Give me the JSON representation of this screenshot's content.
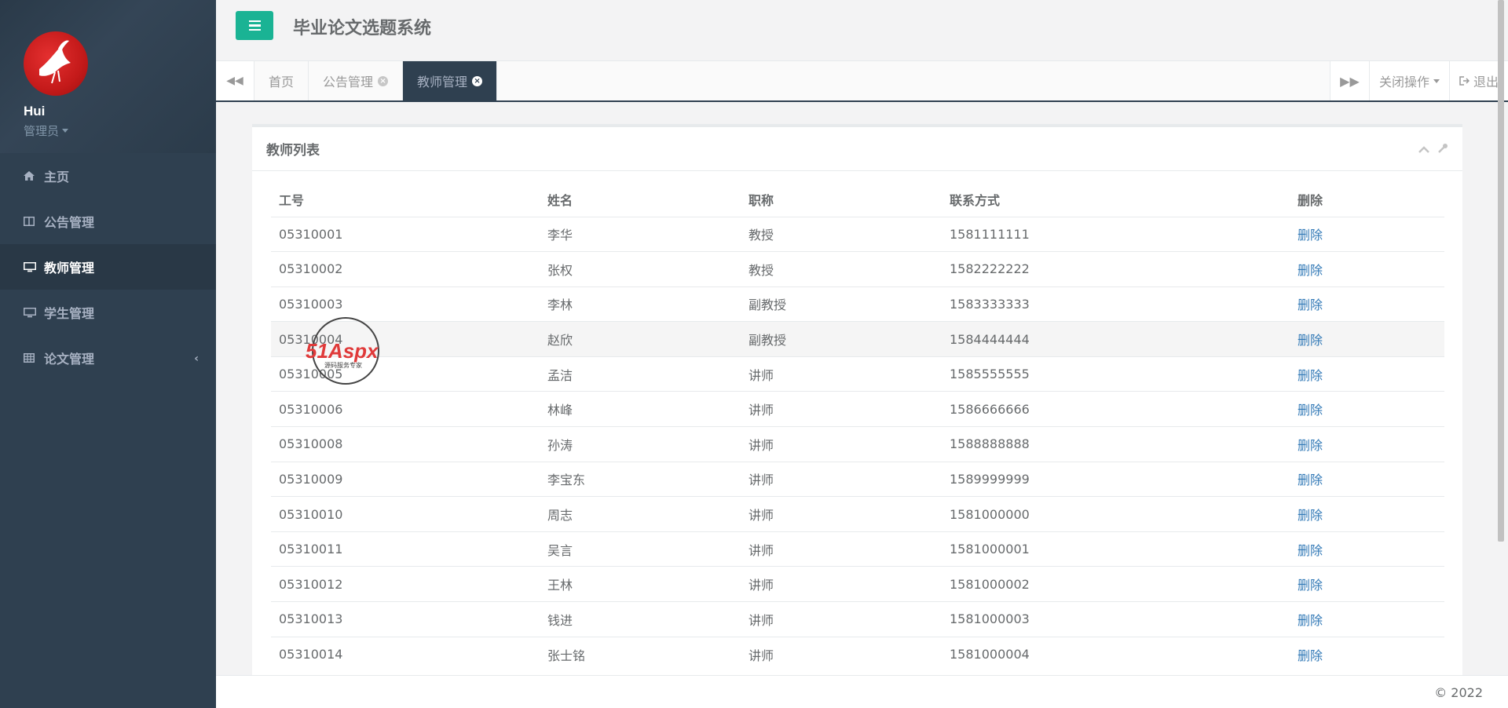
{
  "profile": {
    "name": "Hui",
    "role": "管理员"
  },
  "sidebar": {
    "items": [
      {
        "label": "主页",
        "icon": "home-icon"
      },
      {
        "label": "公告管理",
        "icon": "columns-icon"
      },
      {
        "label": "教师管理",
        "icon": "desktop-icon",
        "active": true
      },
      {
        "label": "学生管理",
        "icon": "desktop-icon"
      },
      {
        "label": "论文管理",
        "icon": "table-icon",
        "has_submenu": true
      }
    ]
  },
  "header": {
    "title": "毕业论文选题系统"
  },
  "tabs": [
    {
      "label": "首页",
      "closable": false
    },
    {
      "label": "公告管理",
      "closable": true
    },
    {
      "label": "教师管理",
      "closable": true,
      "active": true
    }
  ],
  "tabbar_right": {
    "close_ops": "关闭操作",
    "logout": "退出"
  },
  "panel": {
    "title": "教师列表",
    "headers": [
      "工号",
      "姓名",
      "职称",
      "联系方式",
      "删除"
    ],
    "rows": [
      [
        "05310001",
        "李华",
        "教授",
        "1581111111",
        "删除"
      ],
      [
        "05310002",
        "张权",
        "教授",
        "1582222222",
        "删除"
      ],
      [
        "05310003",
        "李林",
        "副教授",
        "1583333333",
        "删除"
      ],
      [
        "05310004",
        "赵欣",
        "副教授",
        "1584444444",
        "删除"
      ],
      [
        "05310005",
        "孟洁",
        "讲师",
        "1585555555",
        "删除"
      ],
      [
        "05310006",
        "林峰",
        "讲师",
        "1586666666",
        "删除"
      ],
      [
        "05310008",
        "孙涛",
        "讲师",
        "1588888888",
        "删除"
      ],
      [
        "05310009",
        "李宝东",
        "讲师",
        "1589999999",
        "删除"
      ],
      [
        "05310010",
        "周志",
        "讲师",
        "1581000000",
        "删除"
      ],
      [
        "05310011",
        "吴言",
        "讲师",
        "1581000001",
        "删除"
      ],
      [
        "05310012",
        "王林",
        "讲师",
        "1581000002",
        "删除"
      ],
      [
        "05310013",
        "钱进",
        "讲师",
        "1581000003",
        "删除"
      ],
      [
        "05310014",
        "张士铭",
        "讲师",
        "1581000004",
        "删除"
      ]
    ],
    "highlight_row": 3
  },
  "watermark": {
    "brand": "51Aspx",
    "tagline": "源码服务专家"
  },
  "footer": {
    "copyright": "© 2022"
  },
  "colors": {
    "accent": "#1ab394",
    "sidebar": "#2f4050",
    "link": "#337ab7"
  }
}
